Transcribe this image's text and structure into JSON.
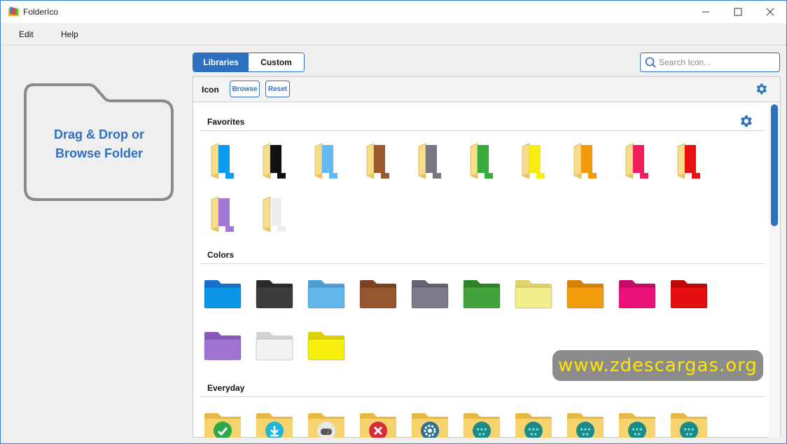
{
  "window": {
    "title": "FolderIco"
  },
  "menu": {
    "items": [
      "Edit",
      "Help"
    ]
  },
  "dropzone": {
    "line1": "Drag & Drop or",
    "line2": "Browse Folder"
  },
  "tabs": [
    {
      "label": "Libraries",
      "active": true
    },
    {
      "label": "Custom",
      "active": false
    }
  ],
  "search": {
    "placeholder": "Search Icon..."
  },
  "toolbar": {
    "label": "Icon",
    "browse": "Browse",
    "reset": "Reset"
  },
  "sections": {
    "favorites": {
      "title": "Favorites",
      "icons": [
        {
          "name": "blue",
          "color": "#0a9cf0"
        },
        {
          "name": "black",
          "color": "#111111"
        },
        {
          "name": "light-blue",
          "color": "#63baf0"
        },
        {
          "name": "brown",
          "color": "#9b5a2e"
        },
        {
          "name": "gray",
          "color": "#787884"
        },
        {
          "name": "green",
          "color": "#3aaa3a"
        },
        {
          "name": "yellow",
          "color": "#f6ee10"
        },
        {
          "name": "orange",
          "color": "#f39a0a"
        },
        {
          "name": "pink",
          "color": "#ee1e5f"
        },
        {
          "name": "red",
          "color": "#ec1111"
        },
        {
          "name": "purple",
          "color": "#a377d6"
        },
        {
          "name": "white",
          "color": "#eeeeee"
        }
      ]
    },
    "colors": {
      "title": "Colors",
      "icons": [
        {
          "name": "blue",
          "color": "#0a95e8",
          "tab": "#1a6fc8"
        },
        {
          "name": "dark",
          "color": "#3b3b3b",
          "tab": "#2a2a2a"
        },
        {
          "name": "light-blue",
          "color": "#62b8ec",
          "tab": "#4d9fd6"
        },
        {
          "name": "brown",
          "color": "#95572f",
          "tab": "#774322"
        },
        {
          "name": "gray",
          "color": "#7d7b8c",
          "tab": "#666474"
        },
        {
          "name": "green",
          "color": "#42a33a",
          "tab": "#2f832a"
        },
        {
          "name": "pale-yellow",
          "color": "#f3ee8a",
          "tab": "#dcd36a"
        },
        {
          "name": "orange",
          "color": "#f39c0c",
          "tab": "#d88308"
        },
        {
          "name": "magenta",
          "color": "#ec107a",
          "tab": "#c40c63"
        },
        {
          "name": "red",
          "color": "#e50e0e",
          "tab": "#bb0a0a"
        },
        {
          "name": "purple",
          "color": "#a073d4",
          "tab": "#8459bb"
        },
        {
          "name": "white",
          "color": "#f2f2f2",
          "tab": "#d4d4d4"
        },
        {
          "name": "yellow",
          "color": "#f7ef0e",
          "tab": "#dbd30a"
        }
      ]
    },
    "everyday": {
      "title": "Everyday",
      "icons": [
        {
          "name": "check",
          "badge": "#2ea84a",
          "symbol": "check"
        },
        {
          "name": "download",
          "badge": "#22b5dc",
          "symbol": "download"
        },
        {
          "name": "gamepad",
          "badge": "#e8e8e8",
          "symbol": "gamepad"
        },
        {
          "name": "delete",
          "badge": "#d92a3a",
          "symbol": "x"
        },
        {
          "name": "settings",
          "badge": "#2f6f8f",
          "symbol": "gear"
        },
        {
          "name": "stars",
          "badge": "#1d8a8a",
          "symbol": "stars"
        },
        {
          "name": "stars",
          "badge": "#1d8a8a",
          "symbol": "stars"
        },
        {
          "name": "stars",
          "badge": "#1d8a8a",
          "symbol": "stars"
        },
        {
          "name": "stars",
          "badge": "#1d8a8a",
          "symbol": "stars"
        },
        {
          "name": "stars",
          "badge": "#1d8a8a",
          "symbol": "stars"
        }
      ]
    }
  },
  "watermark": {
    "text": "www.zdescargas.org"
  },
  "colors": {
    "accent": "#2f6fc0",
    "folder_base": "#f7dc8a"
  }
}
